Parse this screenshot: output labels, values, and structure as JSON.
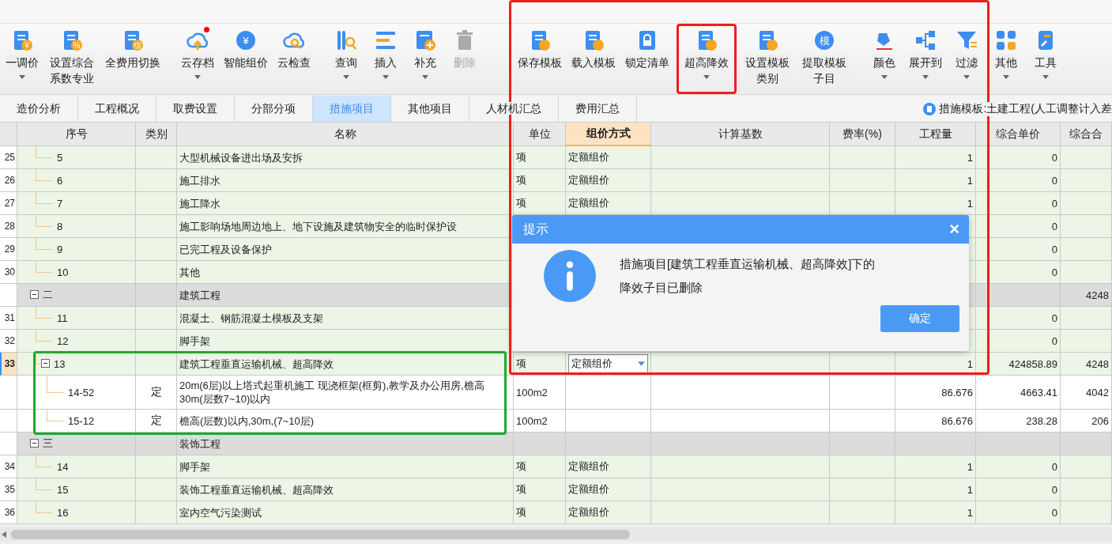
{
  "toolbar": {
    "groups": [
      [
        {
          "label": "一调价",
          "glyph": "¥",
          "caret": true,
          "disabled": false,
          "notification": false
        },
        {
          "label": "设置综合系数专业",
          "glyph": "%",
          "caret": false,
          "disabled": false,
          "notification": false
        },
        {
          "label": "全费用切换",
          "glyph": "综",
          "caret": false,
          "disabled": false,
          "notification": false
        }
      ],
      [
        {
          "label": "云存档",
          "caret": true,
          "disabled": false,
          "notification": true
        },
        {
          "label": "智能组价",
          "glyph": "¥",
          "caret": false,
          "disabled": false,
          "notification": false
        },
        {
          "label": "云检查",
          "caret": false,
          "disabled": false,
          "notification": false
        }
      ],
      [
        {
          "label": "查询",
          "caret": true,
          "disabled": false,
          "notification": false
        },
        {
          "label": "插入",
          "caret": true,
          "disabled": false,
          "notification": false
        },
        {
          "label": "补充",
          "caret": true,
          "disabled": false,
          "notification": false
        },
        {
          "label": "删除",
          "caret": false,
          "disabled": true,
          "notification": false
        }
      ],
      [
        {
          "label": "保存模板",
          "caret": false,
          "disabled": false,
          "notification": false
        },
        {
          "label": "载入模板",
          "caret": false,
          "disabled": false,
          "notification": false
        },
        {
          "label": "锁定清单",
          "caret": false,
          "disabled": false,
          "notification": false
        },
        {
          "label": "超高降效",
          "caret": true,
          "disabled": false,
          "notification": false
        },
        {
          "label": "设置模板类别",
          "caret": false,
          "disabled": false,
          "notification": false
        },
        {
          "label": "提取模板子目",
          "glyph": "模",
          "caret": false,
          "disabled": false,
          "notification": false
        }
      ],
      [
        {
          "label": "颜色",
          "caret": true,
          "disabled": false,
          "notification": false
        },
        {
          "label": "展开到",
          "caret": true,
          "disabled": false,
          "notification": false
        },
        {
          "label": "过滤",
          "caret": true,
          "disabled": false,
          "notification": false
        },
        {
          "label": "其他",
          "caret": true,
          "disabled": false,
          "notification": false
        },
        {
          "label": "工具",
          "caret": true,
          "disabled": false,
          "notification": false
        }
      ]
    ]
  },
  "tabs": [
    {
      "label": "造价分析",
      "selected": false
    },
    {
      "label": "工程概况",
      "selected": false
    },
    {
      "label": "取费设置",
      "selected": false
    },
    {
      "label": "分部分项",
      "selected": false
    },
    {
      "label": "措施项目",
      "selected": true
    },
    {
      "label": "其他项目",
      "selected": false
    },
    {
      "label": "人材机汇总",
      "selected": false
    },
    {
      "label": "费用汇总",
      "selected": false
    }
  ],
  "template_info": "措施模板:土建工程(人工调整计入差",
  "columns": [
    {
      "label": "序号",
      "selected": false
    },
    {
      "label": "类别",
      "selected": false
    },
    {
      "label": "名称",
      "selected": false
    },
    {
      "label": "单位",
      "selected": false
    },
    {
      "label": "组价方式",
      "selected": true
    },
    {
      "label": "计算基数",
      "selected": false
    },
    {
      "label": "费率(%)",
      "selected": false
    },
    {
      "label": "工程量",
      "selected": false
    },
    {
      "label": "综合单价",
      "selected": false
    },
    {
      "label": "综合合",
      "selected": false
    }
  ],
  "rows": [
    {
      "num": "25",
      "seq": "5",
      "kind": "item",
      "name": "大型机械设备进出场及安拆",
      "unit": "项",
      "method": "定额组价",
      "qty": "1",
      "unit_price": "0",
      "selected": false
    },
    {
      "num": "26",
      "seq": "6",
      "kind": "item",
      "name": "施工排水",
      "unit": "项",
      "method": "定额组价",
      "qty": "1",
      "unit_price": "0",
      "selected": false
    },
    {
      "num": "27",
      "seq": "7",
      "kind": "item",
      "name": "施工降水",
      "unit": "项",
      "method": "定额组价",
      "qty": "1",
      "unit_price": "0",
      "selected": false
    },
    {
      "num": "28",
      "seq": "8",
      "kind": "item",
      "name": "施工影响场地周边地上、地下设施及建筑物安全的临时保护设",
      "unit_price": "0",
      "selected": false
    },
    {
      "num": "29",
      "seq": "9",
      "kind": "item",
      "name": "已完工程及设备保护",
      "unit_price": "0",
      "selected": false
    },
    {
      "num": "30",
      "seq": "10",
      "kind": "item",
      "name": "其他",
      "unit_price": "0",
      "selected": false
    },
    {
      "seq": "二",
      "kind": "group",
      "name": "建筑工程",
      "total": "4248",
      "expanded": true,
      "selected": false,
      "children": [
        {
          "num": "31",
          "seq": "11",
          "kind": "item",
          "name": "混凝土、钢筋混凝土模板及支架",
          "unit_price": "0",
          "selected": false
        },
        {
          "num": "32",
          "seq": "12",
          "kind": "item",
          "name": "脚手架",
          "unit_price": "0",
          "selected": false
        },
        {
          "num": "33",
          "seq": "13",
          "kind": "item",
          "name": "建筑工程垂直运输机械、超高降效",
          "unit": "项",
          "method": "定额组价",
          "qty": "1",
          "unit_price": "424858.89",
          "total": "4248",
          "expanded": true,
          "selected": true,
          "children": [
            {
              "seq": "14-52",
              "kind": "quota",
              "type": "定",
              "name": "20m(6层)以上塔式起重机施工 现浇框架(框剪),教学及办公用房,檐高30m(层数7~10)以内",
              "unit": "100m2",
              "qty": "86.676",
              "unit_price": "4663.41",
              "total": "4042",
              "selected": false
            },
            {
              "seq": "15-12",
              "kind": "quota",
              "type": "定",
              "name": "檐高(层数)以内,30m,(7~10层)",
              "unit": "100m2",
              "qty": "86.676",
              "unit_price": "238.28",
              "total": "206",
              "selected": false
            }
          ]
        }
      ]
    },
    {
      "seq": "三",
      "kind": "group",
      "name": "装饰工程",
      "expanded": true,
      "selected": false,
      "children": [
        {
          "num": "34",
          "seq": "14",
          "kind": "item",
          "name": "脚手架",
          "unit": "项",
          "method": "定额组价",
          "qty": "1",
          "unit_price": "0",
          "selected": false
        },
        {
          "num": "35",
          "seq": "15",
          "kind": "item",
          "name": "装饰工程垂直运输机械、超高降效",
          "unit": "项",
          "method": "定额组价",
          "qty": "1",
          "unit_price": "0",
          "selected": false
        },
        {
          "num": "36",
          "seq": "16",
          "kind": "item",
          "name": "室内空气污染测试",
          "unit": "项",
          "method": "定额组价",
          "qty": "1",
          "unit_price": "0",
          "selected": false
        }
      ]
    }
  ],
  "dialog": {
    "title": "提示",
    "close": "×",
    "message": "措施项目[建筑工程垂直运输机械、超高降效]下的降效子目已删除",
    "button": "确定"
  },
  "highlight_frames": [
    {
      "color": "#f21c1c"
    },
    {
      "color": "#f21c1c"
    },
    {
      "color": "#1faa2a"
    }
  ]
}
